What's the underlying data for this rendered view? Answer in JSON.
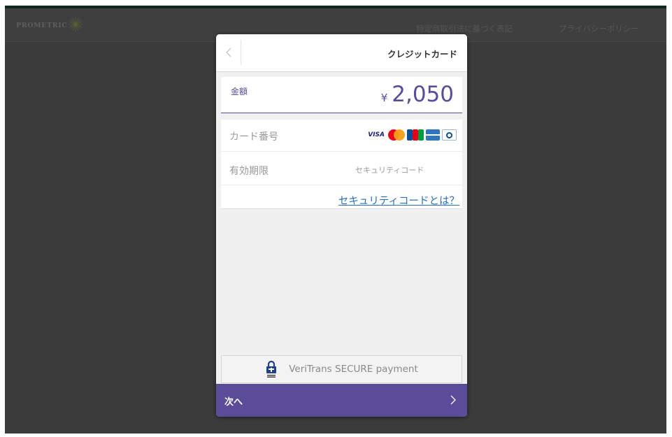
{
  "header": {
    "logo_text": "PROMETRIC",
    "links": {
      "legal": "特定商取引法に基づく表記",
      "privacy": "プライバシーポリシー"
    }
  },
  "modal": {
    "title": "クレジットカード",
    "amount": {
      "label": "金額",
      "currency": "¥",
      "value": "2,050"
    },
    "card_form": {
      "card_number_label": "カード番号",
      "brands": [
        "VISA",
        "Mastercard",
        "JCB",
        "American Express",
        "Diners Club"
      ],
      "visa_text": "VISA",
      "expiry_label": "有効期限",
      "security_code_label": "セキュリティコード",
      "security_code_link": "セキュリティコードとは？"
    },
    "secure_text": "VeriTrans SECURE payment",
    "next_label": "次へ"
  },
  "colors": {
    "accent": "#5b4c9a",
    "link": "#2a6fb6",
    "backdrop": "#3b3b3b"
  }
}
